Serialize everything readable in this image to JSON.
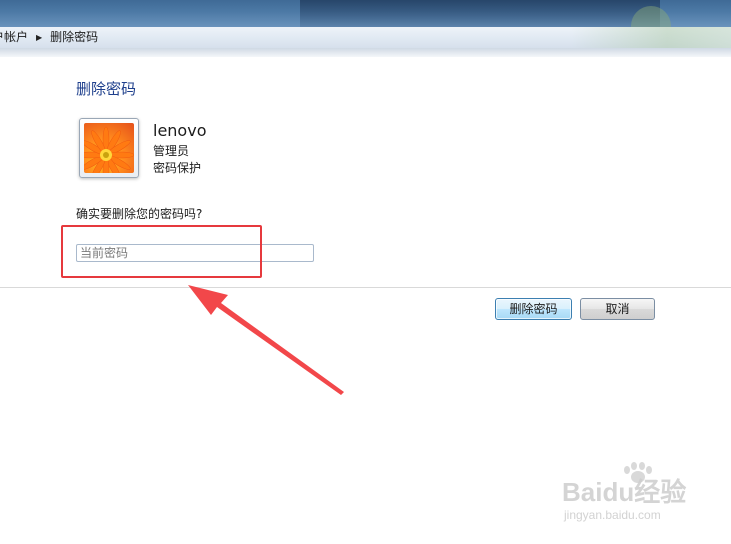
{
  "breadcrumb": {
    "prev_item": "户帐户",
    "current_item": "删除密码"
  },
  "page": {
    "title": "删除密码"
  },
  "user": {
    "name": "lenovo",
    "role": "管理员",
    "status": "密码保护"
  },
  "form": {
    "question": "确实要删除您的密码吗?",
    "password_placeholder": "当前密码",
    "password_value": ""
  },
  "buttons": {
    "delete_label": "删除密码",
    "cancel_label": "取消"
  },
  "annotation": {
    "highlight_color": "#e6393d"
  },
  "watermark": {
    "brand": "Baidu经验",
    "site": "jingyan.baidu.com"
  },
  "icons": {
    "avatar": "orange-flower-avatar-icon",
    "breadcrumb_separator": "triangle-right-icon",
    "annotation_arrow": "red-arrow-icon"
  }
}
